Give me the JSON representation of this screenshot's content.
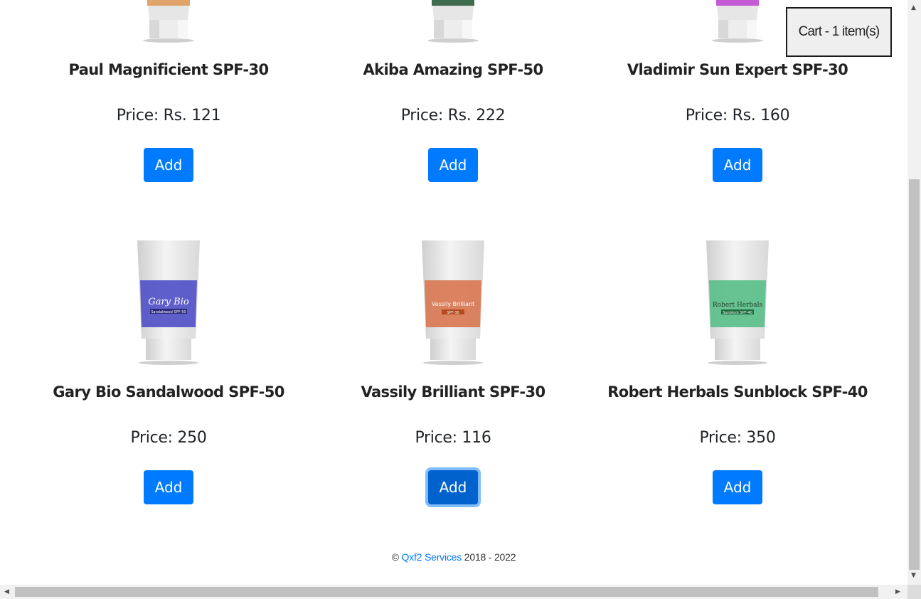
{
  "cart": {
    "label": "Cart - 1 item(s)"
  },
  "products_row1": [
    {
      "name": "Paul Magnificient SPF-30",
      "price": "Price: Rs. 121",
      "button": "Add",
      "cap_color": "#e0a46a"
    },
    {
      "name": "Akiba Amazing SPF-50",
      "price": "Price: Rs. 222",
      "button": "Add",
      "cap_color": "#3f6b4e"
    },
    {
      "name": "Vladimir Sun Expert SPF-30",
      "price": "Price: Rs. 160",
      "button": "Add",
      "cap_color": "#c45ad6"
    }
  ],
  "products_row2": [
    {
      "name": "Gary Bio Sandalwood SPF-50",
      "price": "Price: 250",
      "button": "Add",
      "label_brand": "Gary Bio",
      "label_sub": "Sandalwood SPF-50",
      "label_color": "#5252c8"
    },
    {
      "name": "Vassily Brilliant SPF-30",
      "price": "Price: 116",
      "button": "Add",
      "label_brand": "Vassily Brilliant",
      "label_sub": "SPF-30",
      "label_color": "#d97a55"
    },
    {
      "name": "Robert Herbals Sunblock SPF-40",
      "price": "Price: 350",
      "button": "Add",
      "label_brand": "Robert Herbals",
      "label_sub": "Sunblock SPF-40",
      "label_color": "#5cbf8a"
    }
  ],
  "footer": {
    "prefix": "©",
    "company": "Qxf2 Services",
    "years": "2018 - 2022"
  },
  "colors": {
    "button": "#007bff",
    "link": "#007bff"
  }
}
